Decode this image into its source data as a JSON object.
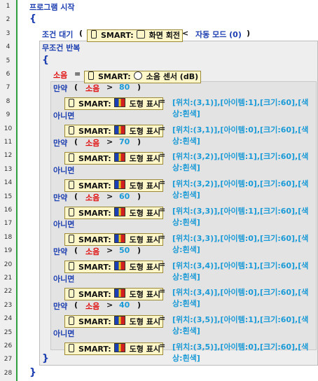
{
  "line_numbers": [
    "1",
    "2",
    "3",
    "4",
    "5",
    "6",
    "7",
    "8",
    "9",
    "10",
    "11",
    "12",
    "13",
    "14",
    "15",
    "16",
    "17",
    "18",
    "19",
    "20",
    "21",
    "22",
    "23",
    "24",
    "25",
    "26",
    "27",
    "28"
  ],
  "program_start": "프로그램 시작",
  "open_brace": "{",
  "close_brace": "}",
  "wait_keyword": "조건 대기",
  "paren_open": "(",
  "paren_close": ")",
  "smart_label": "SMART:",
  "screen_rotate": "화면 회전",
  "less_than": "<",
  "auto_mode": "자동 모드 (0)",
  "loop_keyword": "무조건 반복",
  "var_sound": "소음",
  "equals": "=",
  "sound_sensor": "소음 센서 (dB)",
  "if_keyword": "만약",
  "else_keyword": "아니면",
  "greater": ">",
  "shape_display": "도형 표시",
  "thresholds": [
    "80",
    "70",
    "60",
    "50",
    "40"
  ],
  "actions": [
    "[위치:(3,1)],[아이템:1],[크기:60],[색상:흰색]",
    "[위치:(3,1)],[아이템:0],[크기:60],[색상:흰색]",
    "[위치:(3,2)],[아이템:1],[크기:60],[색상:흰색]",
    "[위치:(3,2)],[아이템:0],[크기:60],[색상:흰색]",
    "[위치:(3,3)],[아이템:1],[크기:60],[색상:흰색]",
    "[위치:(3,3)],[아이템:0],[크기:60],[색상:흰색]",
    "[위치:(3,4)],[아이템:1],[크기:60],[색상:흰색]",
    "[위치:(3,4)],[아이템:0],[크기:60],[색상:흰색]",
    "[위치:(3,5)],[아이템:1],[크기:60],[색상:흰색]",
    "[위치:(3,5)],[아이템:0],[크기:60],[색상:흰색]"
  ],
  "colors": {
    "keyword": "#1e3fb0",
    "variable": "#e01010",
    "number": "#1a9ad6",
    "chip_bg": "#fdf6c8",
    "gutter_line": "#2e9e3e"
  }
}
